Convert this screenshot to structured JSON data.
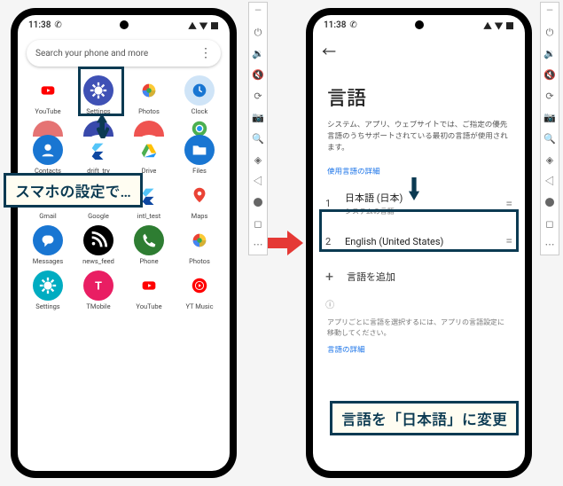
{
  "status": {
    "time": "11:38",
    "icons": "▲ ▼ ■"
  },
  "left": {
    "search_placeholder": "Search your phone and more",
    "apps": [
      [
        {
          "n": "YouTube",
          "c": "#fff",
          "svg": "yt"
        },
        {
          "n": "Settings",
          "c": "#3f51b5",
          "svg": "gear"
        },
        {
          "n": "Photos",
          "c": "#fff",
          "svg": "photos"
        },
        {
          "n": "Clock",
          "c": "#cfe4f7",
          "svg": "clock"
        }
      ],
      [
        {
          "n": "",
          "c": "#e57373"
        },
        {
          "n": "",
          "c": "#3949ab"
        },
        {
          "n": "",
          "c": "#ef5350"
        },
        {
          "n": "",
          "c": "#fff",
          "svg": "chrome"
        }
      ],
      [
        {
          "n": "Contacts",
          "c": "#1976d2",
          "svg": "person"
        },
        {
          "n": "drift_try",
          "c": "#fff",
          "svg": "flutter"
        },
        {
          "n": "Drive",
          "c": "#fff",
          "svg": "drive"
        },
        {
          "n": "Files",
          "c": "#1976d2",
          "svg": "folder"
        }
      ],
      [
        {
          "n": "Gmail",
          "c": "#fff",
          "svg": "gmail"
        },
        {
          "n": "Google",
          "c": "#fff",
          "svg": "g"
        },
        {
          "n": "intl_test",
          "c": "#fff",
          "svg": "flutter"
        },
        {
          "n": "Maps",
          "c": "#fff",
          "svg": "maps"
        }
      ],
      [
        {
          "n": "Messages",
          "c": "#1976d2",
          "svg": "msg"
        },
        {
          "n": "news_feed",
          "c": "#000",
          "svg": "rss"
        },
        {
          "n": "Phone",
          "c": "#2e7d32",
          "svg": "phone"
        },
        {
          "n": "Photos",
          "c": "#fff",
          "svg": "photos"
        }
      ],
      [
        {
          "n": "Settings",
          "c": "#00acc1",
          "svg": "gear"
        },
        {
          "n": "TMobile",
          "c": "#e91e63",
          "svg": "t"
        },
        {
          "n": "YouTube",
          "c": "#fff",
          "svg": "yt"
        },
        {
          "n": "YT Music",
          "c": "#fff",
          "svg": "ytm"
        }
      ]
    ],
    "callout": "スマホの設定で…"
  },
  "right": {
    "title": "言語",
    "desc": "システム、アプリ、ウェブサイトでは、ご指定の優先言語のうちサポートされている最初の言語が使用されます。",
    "sect1": "使用言語の詳細",
    "lang1": {
      "num": "1",
      "name": "日本語 (日本)",
      "sub": "システムの言語"
    },
    "lang2": {
      "num": "2",
      "name": "English (United States)"
    },
    "add": "言語を追加",
    "foot_desc": "アプリごとに言語を選択するには、アプリの言語設定に移動してください。",
    "sect2": "言語の詳細",
    "callout": "言語を「日本語」に変更"
  },
  "toolbar_icons": [
    "⏻",
    "🔉",
    "🔇",
    "⟳",
    "📷",
    "🔍",
    "◈",
    "◁",
    "●",
    "◻",
    "⋯"
  ]
}
